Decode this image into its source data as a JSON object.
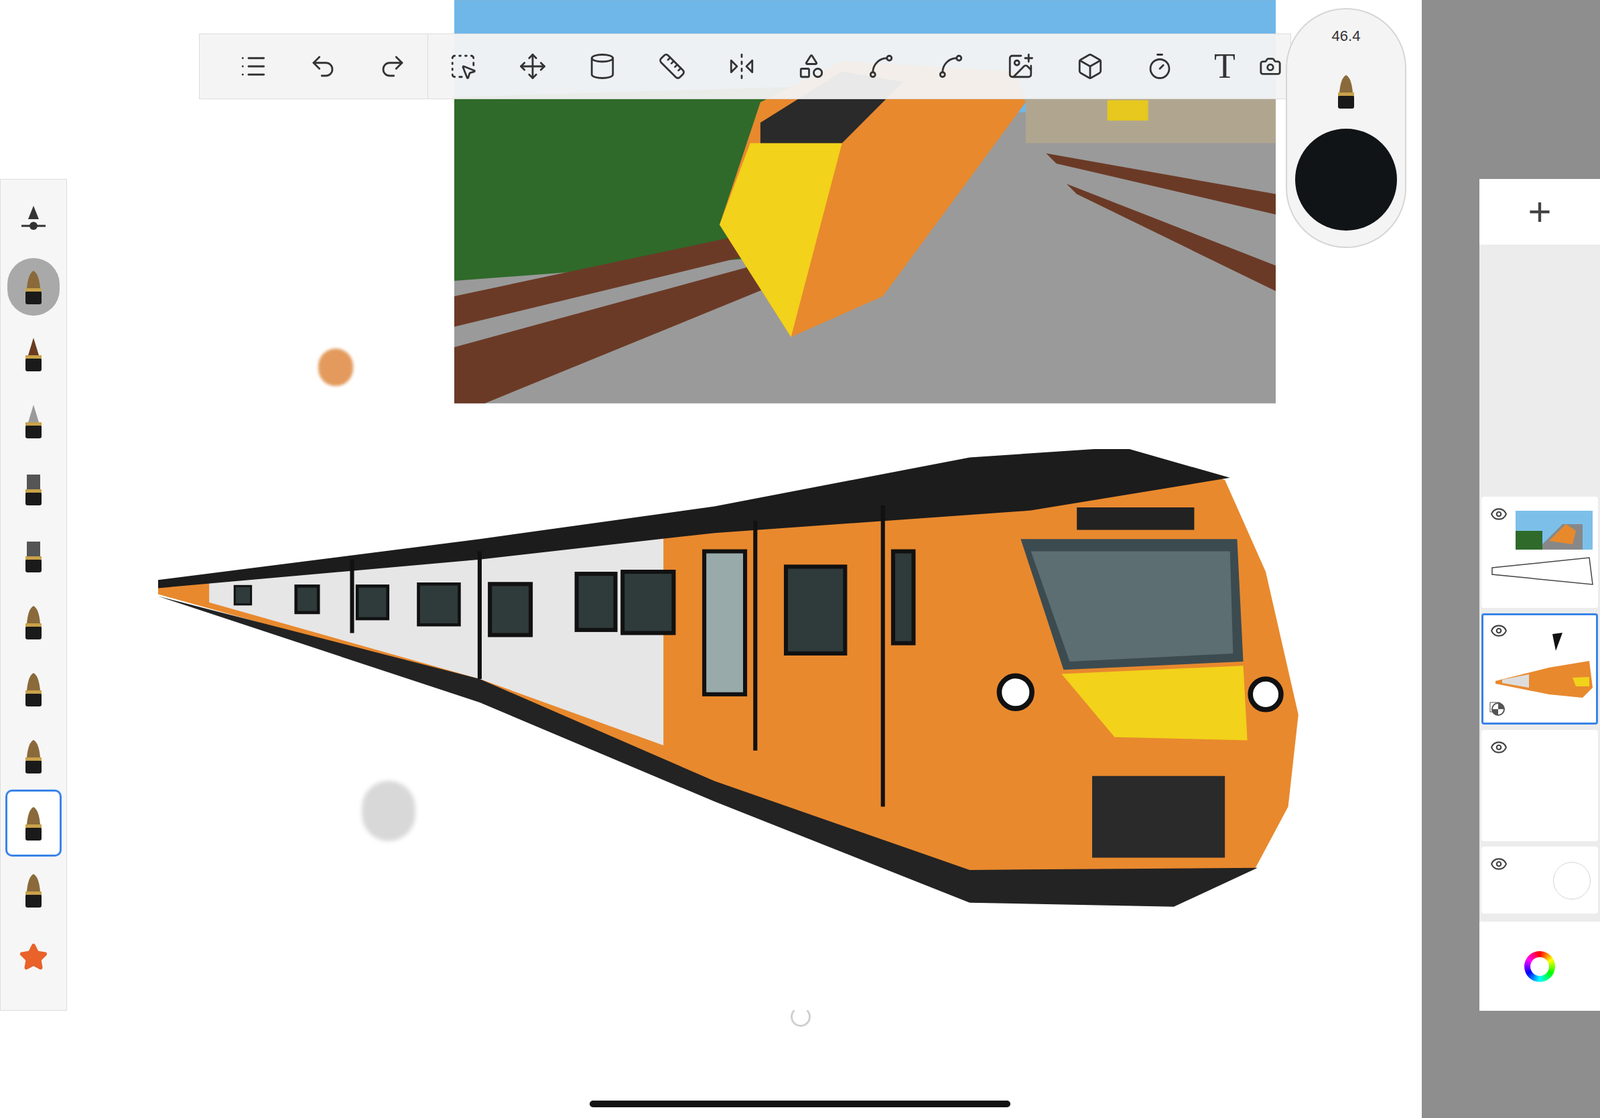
{
  "toolbar": {
    "text_tool": "T"
  },
  "brush_puck": {
    "size": "46.4",
    "color": "#111417"
  },
  "brush_palette": [
    {
      "kind": "slider",
      "selected": false,
      "highlighted": false
    },
    {
      "kind": "brush",
      "selected": false,
      "highlighted": true
    },
    {
      "kind": "pen",
      "selected": false,
      "highlighted": false
    },
    {
      "kind": "pencil",
      "selected": false,
      "highlighted": false
    },
    {
      "kind": "marker",
      "selected": false,
      "highlighted": false
    },
    {
      "kind": "marker",
      "selected": false,
      "highlighted": false
    },
    {
      "kind": "brush",
      "selected": false,
      "highlighted": false
    },
    {
      "kind": "brush",
      "selected": false,
      "highlighted": false
    },
    {
      "kind": "brush",
      "selected": false,
      "highlighted": false
    },
    {
      "kind": "brush",
      "selected": true,
      "highlighted": false
    },
    {
      "kind": "brush",
      "selected": false,
      "highlighted": false
    },
    {
      "kind": "star",
      "selected": false,
      "highlighted": false
    }
  ],
  "layers": {
    "add_button": "+",
    "items": [
      {
        "kind": "photo",
        "visible": true,
        "selected": false,
        "alpha_locked": false
      },
      {
        "kind": "drawing",
        "visible": true,
        "selected": true,
        "alpha_locked": true
      },
      {
        "kind": "empty",
        "visible": true,
        "selected": false,
        "alpha_locked": false
      },
      {
        "kind": "background",
        "visible": true,
        "selected": false,
        "alpha_locked": false
      }
    ]
  }
}
